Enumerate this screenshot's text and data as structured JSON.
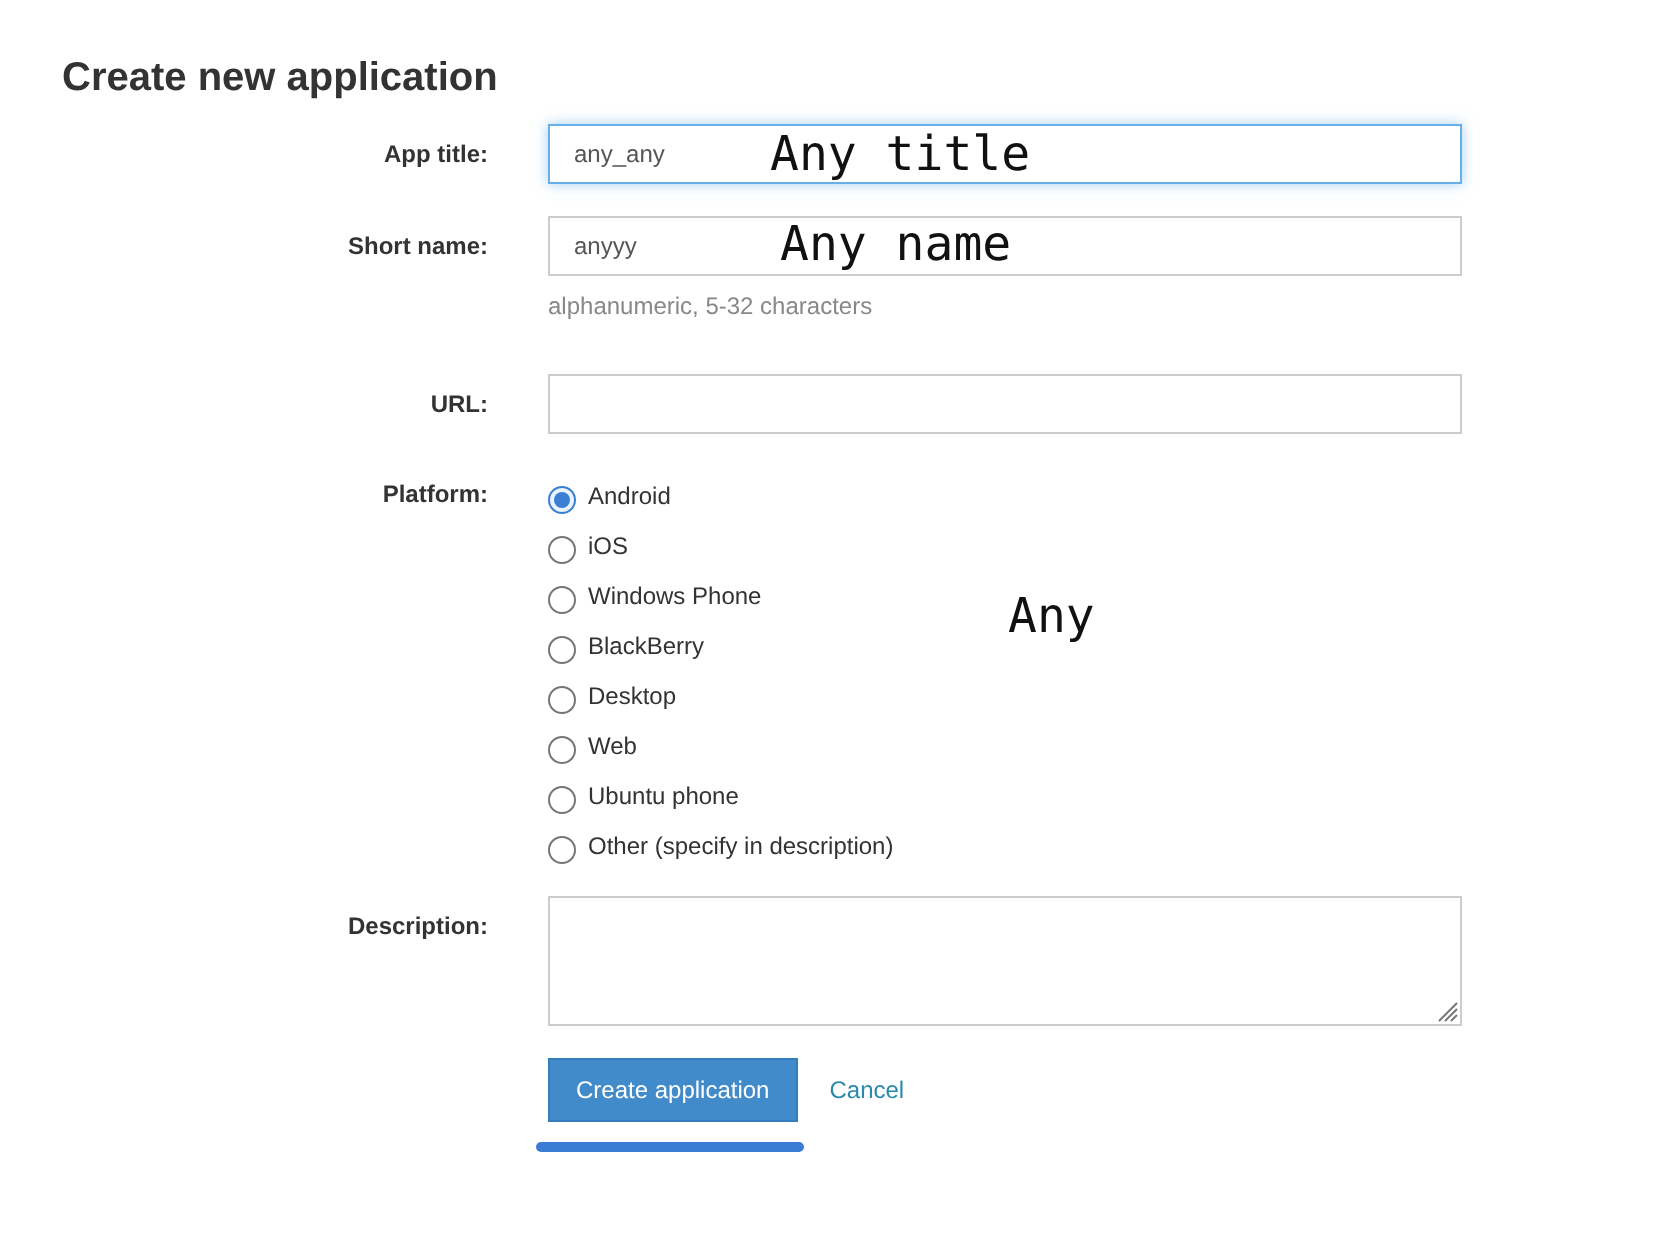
{
  "page": {
    "title": "Create new application"
  },
  "fields": [
    {
      "kind": "text",
      "label": "App title:",
      "value": "any_any",
      "focused": true,
      "annotation": "Any title"
    },
    {
      "kind": "text",
      "label": "Short name:",
      "value": "anyyy",
      "focused": false,
      "hint": "alphanumeric, 5-32 characters",
      "annotation": "Any name"
    },
    {
      "kind": "text",
      "label": "URL:",
      "focused": false
    },
    {
      "kind": "radio",
      "label": "Platform:",
      "options": [
        {
          "label": "Android",
          "selected": true
        },
        {
          "label": "iOS",
          "selected": false
        },
        {
          "label": "Windows Phone",
          "selected": false
        },
        {
          "label": "BlackBerry",
          "selected": false
        },
        {
          "label": "Desktop",
          "selected": false
        },
        {
          "label": "Web",
          "selected": false
        },
        {
          "label": "Ubuntu phone",
          "selected": false
        },
        {
          "label": "Other (specify in description)",
          "selected": false
        }
      ],
      "annotation": "Any"
    },
    {
      "kind": "textarea",
      "label": "Description:",
      "focused": false
    }
  ],
  "actions": {
    "submit": "Create application",
    "cancel": "Cancel"
  }
}
